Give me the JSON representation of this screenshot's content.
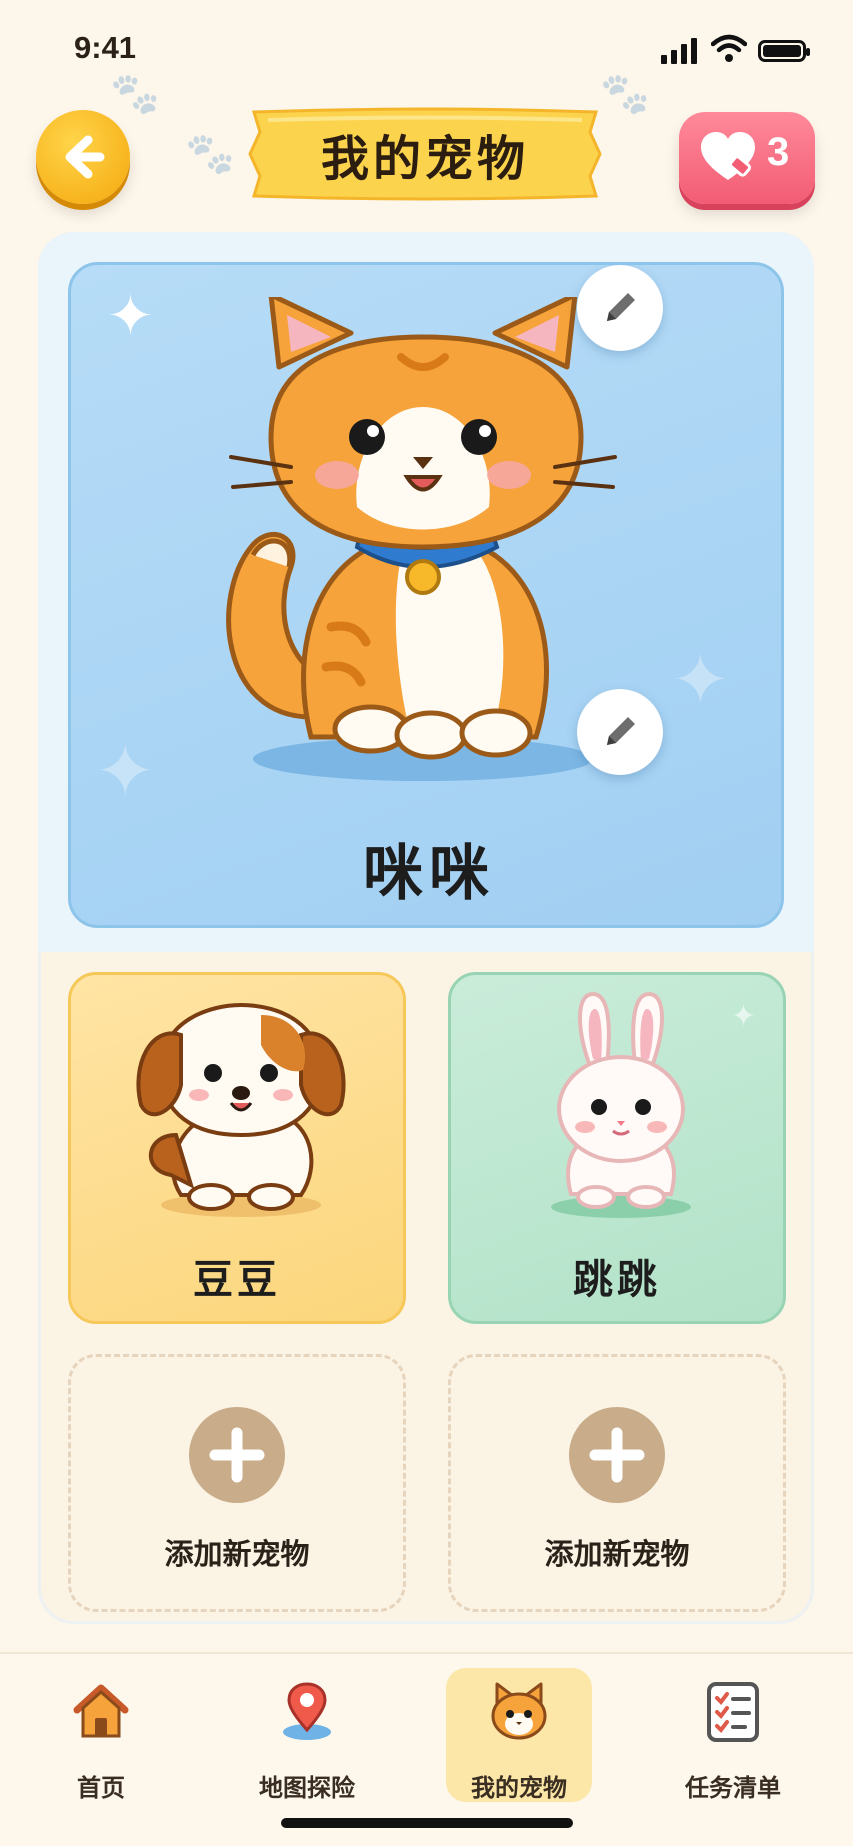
{
  "status_bar": {
    "time": "9:41"
  },
  "header": {
    "title": "我的宠物",
    "hearts_count": "3"
  },
  "featured_pet": {
    "name": "咪咪"
  },
  "pets": [
    {
      "name": "豆豆"
    },
    {
      "name": "跳跳"
    }
  ],
  "add_slots": [
    {
      "label": "添加新宠物"
    },
    {
      "label": "添加新宠物"
    }
  ],
  "nav": [
    {
      "label": "首页",
      "icon": "house-icon"
    },
    {
      "label": "地图探险",
      "icon": "map-pin-icon"
    },
    {
      "label": "我的宠物",
      "icon": "cat-face-icon"
    },
    {
      "label": "任务清单",
      "icon": "checklist-icon"
    }
  ],
  "colors": {
    "accent_yellow": "#f4a70c",
    "heart_pink": "#f25c74",
    "featured_blue": "#a1cff2",
    "active_tab": "#fde7a8"
  }
}
